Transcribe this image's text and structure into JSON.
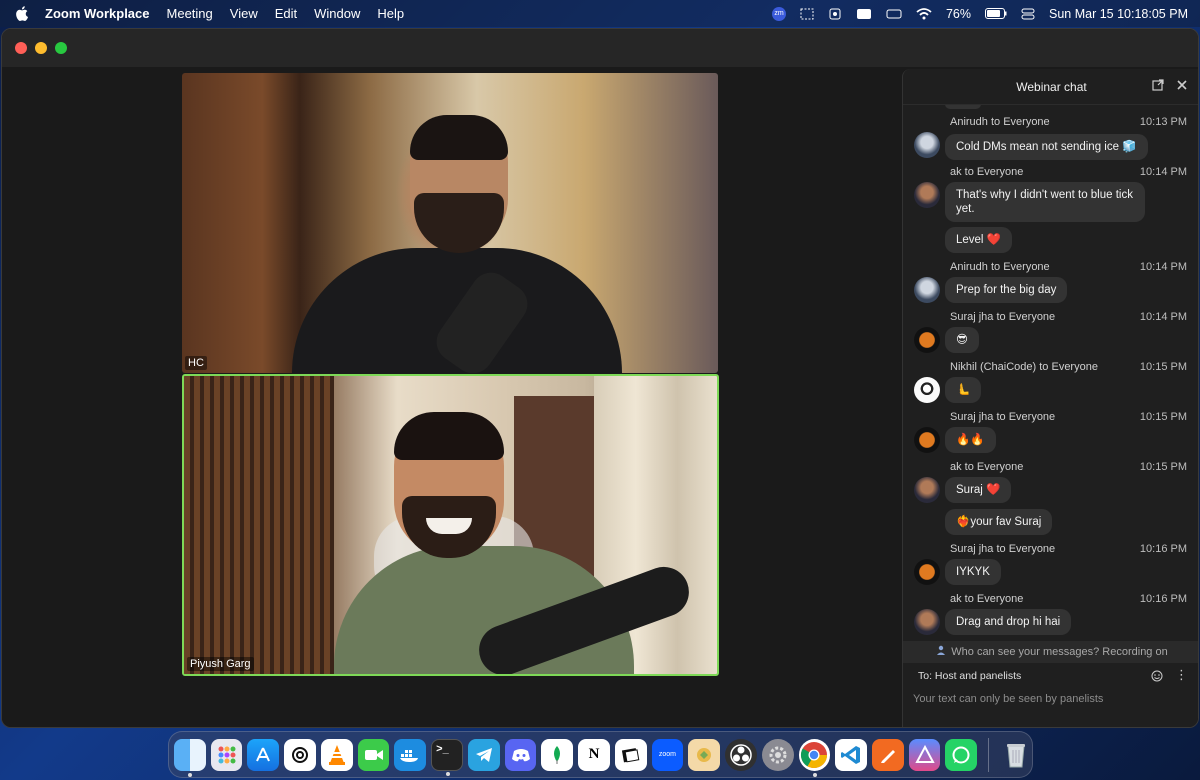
{
  "menubar": {
    "app_name": "Zoom Workplace",
    "items": [
      "Meeting",
      "View",
      "Edit",
      "Window",
      "Help"
    ],
    "battery": "76%",
    "datetime": "Sun Mar 15  10:18:05 PM",
    "zoom_badge": "zm"
  },
  "participants": [
    {
      "name": "HC"
    },
    {
      "name": "Piyush Garg",
      "active_speaker": true
    }
  ],
  "chat": {
    "title": "Webinar chat",
    "messages": [
      {
        "sender": "Anirudh to Everyone",
        "time": "10:13 PM",
        "texts": [
          "Cold DMs mean not sending ice 🧊"
        ]
      },
      {
        "sender": "ak to Everyone",
        "time": "10:14 PM",
        "texts": [
          "That's why I didn't went to blue tick yet.",
          "Level ❤️"
        ]
      },
      {
        "sender": "Anirudh to Everyone",
        "time": "10:14 PM",
        "texts": [
          "Prep for the big day"
        ]
      },
      {
        "sender": "Suraj jha to Everyone",
        "time": "10:14 PM",
        "texts": [
          "😎"
        ]
      },
      {
        "sender": "Nikhil (ChaiCode) to Everyone",
        "time": "10:15 PM",
        "texts": [
          "🫷"
        ]
      },
      {
        "sender": "Suraj jha to Everyone",
        "time": "10:15 PM",
        "texts": [
          "🔥🔥"
        ]
      },
      {
        "sender": "ak to Everyone",
        "time": "10:15 PM",
        "texts": [
          "Suraj ❤️",
          "❤️‍🔥your fav Suraj"
        ]
      },
      {
        "sender": "Suraj jha to Everyone",
        "time": "10:16 PM",
        "texts": [
          "IYKYK"
        ]
      },
      {
        "sender": "ak to Everyone",
        "time": "10:16 PM",
        "texts": [
          "Drag and drop hi hai"
        ]
      }
    ],
    "privacy_notice": "Who can see your messages? Recording on",
    "to_label": "To: Host and panelists",
    "input_placeholder": "Your text can only be seen by panelists"
  },
  "dock": {
    "apps": [
      "Finder",
      "Launchpad",
      "App Store",
      "ChatGPT",
      "VLC",
      "FaceTime",
      "Docker",
      "Terminal",
      "Telegram",
      "Discord",
      "MongoDB Compass",
      "Notion",
      "Preview",
      "Zoom",
      "Archive",
      "OBS",
      "System Settings",
      "Chrome",
      "VS Code",
      "Pencil",
      "Xcode",
      "WhatsApp",
      "Trash"
    ],
    "zoom_label": "zoom"
  }
}
